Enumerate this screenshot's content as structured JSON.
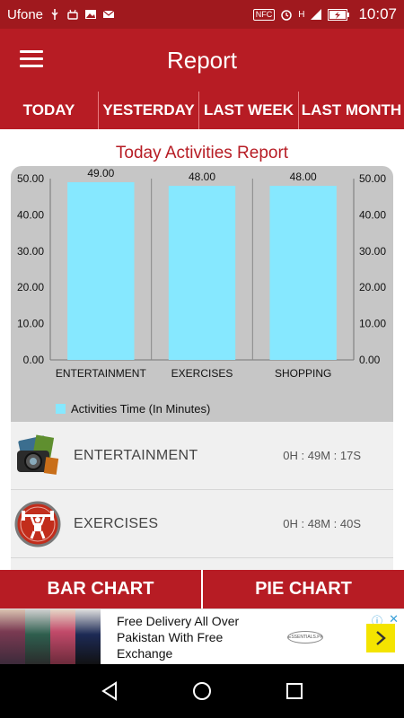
{
  "status_bar": {
    "carrier": "Ufone",
    "nfc": "NFC",
    "signal": "H",
    "time": "10:07"
  },
  "app_bar": {
    "title": "Report",
    "menu_icon": "hamburger-menu-icon"
  },
  "tabs": [
    {
      "label": "TODAY"
    },
    {
      "label": "YESTERDAY"
    },
    {
      "label": "LAST WEEK"
    },
    {
      "label": "LAST MONTH"
    }
  ],
  "report": {
    "title": "Today Activities Report"
  },
  "chart_data": {
    "type": "bar",
    "categories": [
      "ENTERTAINMENT",
      "EXERCISES",
      "SHOPPING"
    ],
    "series": [
      {
        "name": "Activities Time (In Minutes)",
        "values": [
          49.0,
          48.0,
          48.0
        ],
        "color": "#86e8ff"
      }
    ],
    "data_labels": [
      "49.00",
      "48.00",
      "48.00"
    ],
    "ylim": [
      0,
      50
    ],
    "yticks": [
      "0.00",
      "10.00",
      "20.00",
      "30.00",
      "40.00",
      "50.00"
    ],
    "right_axis": true,
    "grid": "vertical",
    "legend_position": "bottom-left",
    "background": "#c6c6c6"
  },
  "activities": [
    {
      "name": "ENTERTAINMENT",
      "duration": "0H : 49M : 17S",
      "icon": "camera-film-icon"
    },
    {
      "name": "EXERCISES",
      "duration": "0H : 48M : 40S",
      "icon": "weightlifter-icon"
    }
  ],
  "chart_buttons": {
    "bar": "BAR CHART",
    "pie": "PIE CHART"
  },
  "ad": {
    "text": "Free Delivery All Over Pakistan With Free Exchange",
    "logo_text": "ESSENTIALS.PK",
    "cta_icon": "chevron-right-icon"
  },
  "colors": {
    "primary": "#b71c24",
    "status_bar": "#a0191e",
    "bar": "#86e8ff",
    "chart_bg": "#c6c6c6"
  }
}
